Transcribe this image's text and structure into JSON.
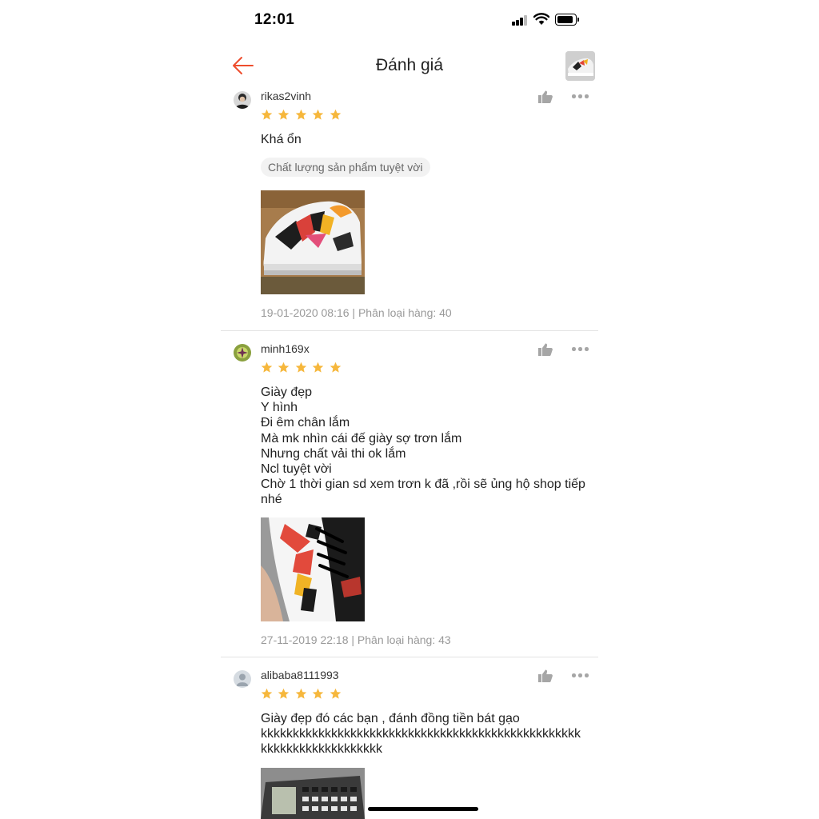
{
  "status_bar": {
    "time": "12:01"
  },
  "header": {
    "title": "Đánh giá",
    "back_icon": "arrow-left-icon",
    "accent_color": "#ee4d2d"
  },
  "reviews": [
    {
      "username": "rikas2vinh",
      "rating": 5,
      "text": "Khá ổn",
      "tag": "Chất lượng sản phẩm tuyệt vời",
      "meta": "19-01-2020 08:16 | Phân loại hàng: 40"
    },
    {
      "username": "minh169x",
      "rating": 5,
      "text": "Giày đẹp\nY hình\nĐi êm chân lắm\nMà mk nhìn cái đế giày sợ trơn lắm\nNhưng chất vải thi ok lắm\nNcl tuyệt vời\nChờ 1 thời gian sd  xem trơn k đã  ,rồi sẽ ủng hộ shop tiếp nhé",
      "meta": "27-11-2019 22:18 | Phân loại hàng: 43"
    },
    {
      "username": "alibaba8111993",
      "rating": 5,
      "text": "Giày đẹp đó các bạn , đánh đồng tiền bát gạo\nkkkkkkkkkkkkkkkkkkkkkkkkkkkkkkkkkkkkkkkkkkkkkkkkkk\nkkkkkkkkkkkkkkkkkkk"
    }
  ],
  "colors": {
    "star": "#f6b73c",
    "meta_text": "#999999",
    "divider": "#e3e3e3"
  }
}
